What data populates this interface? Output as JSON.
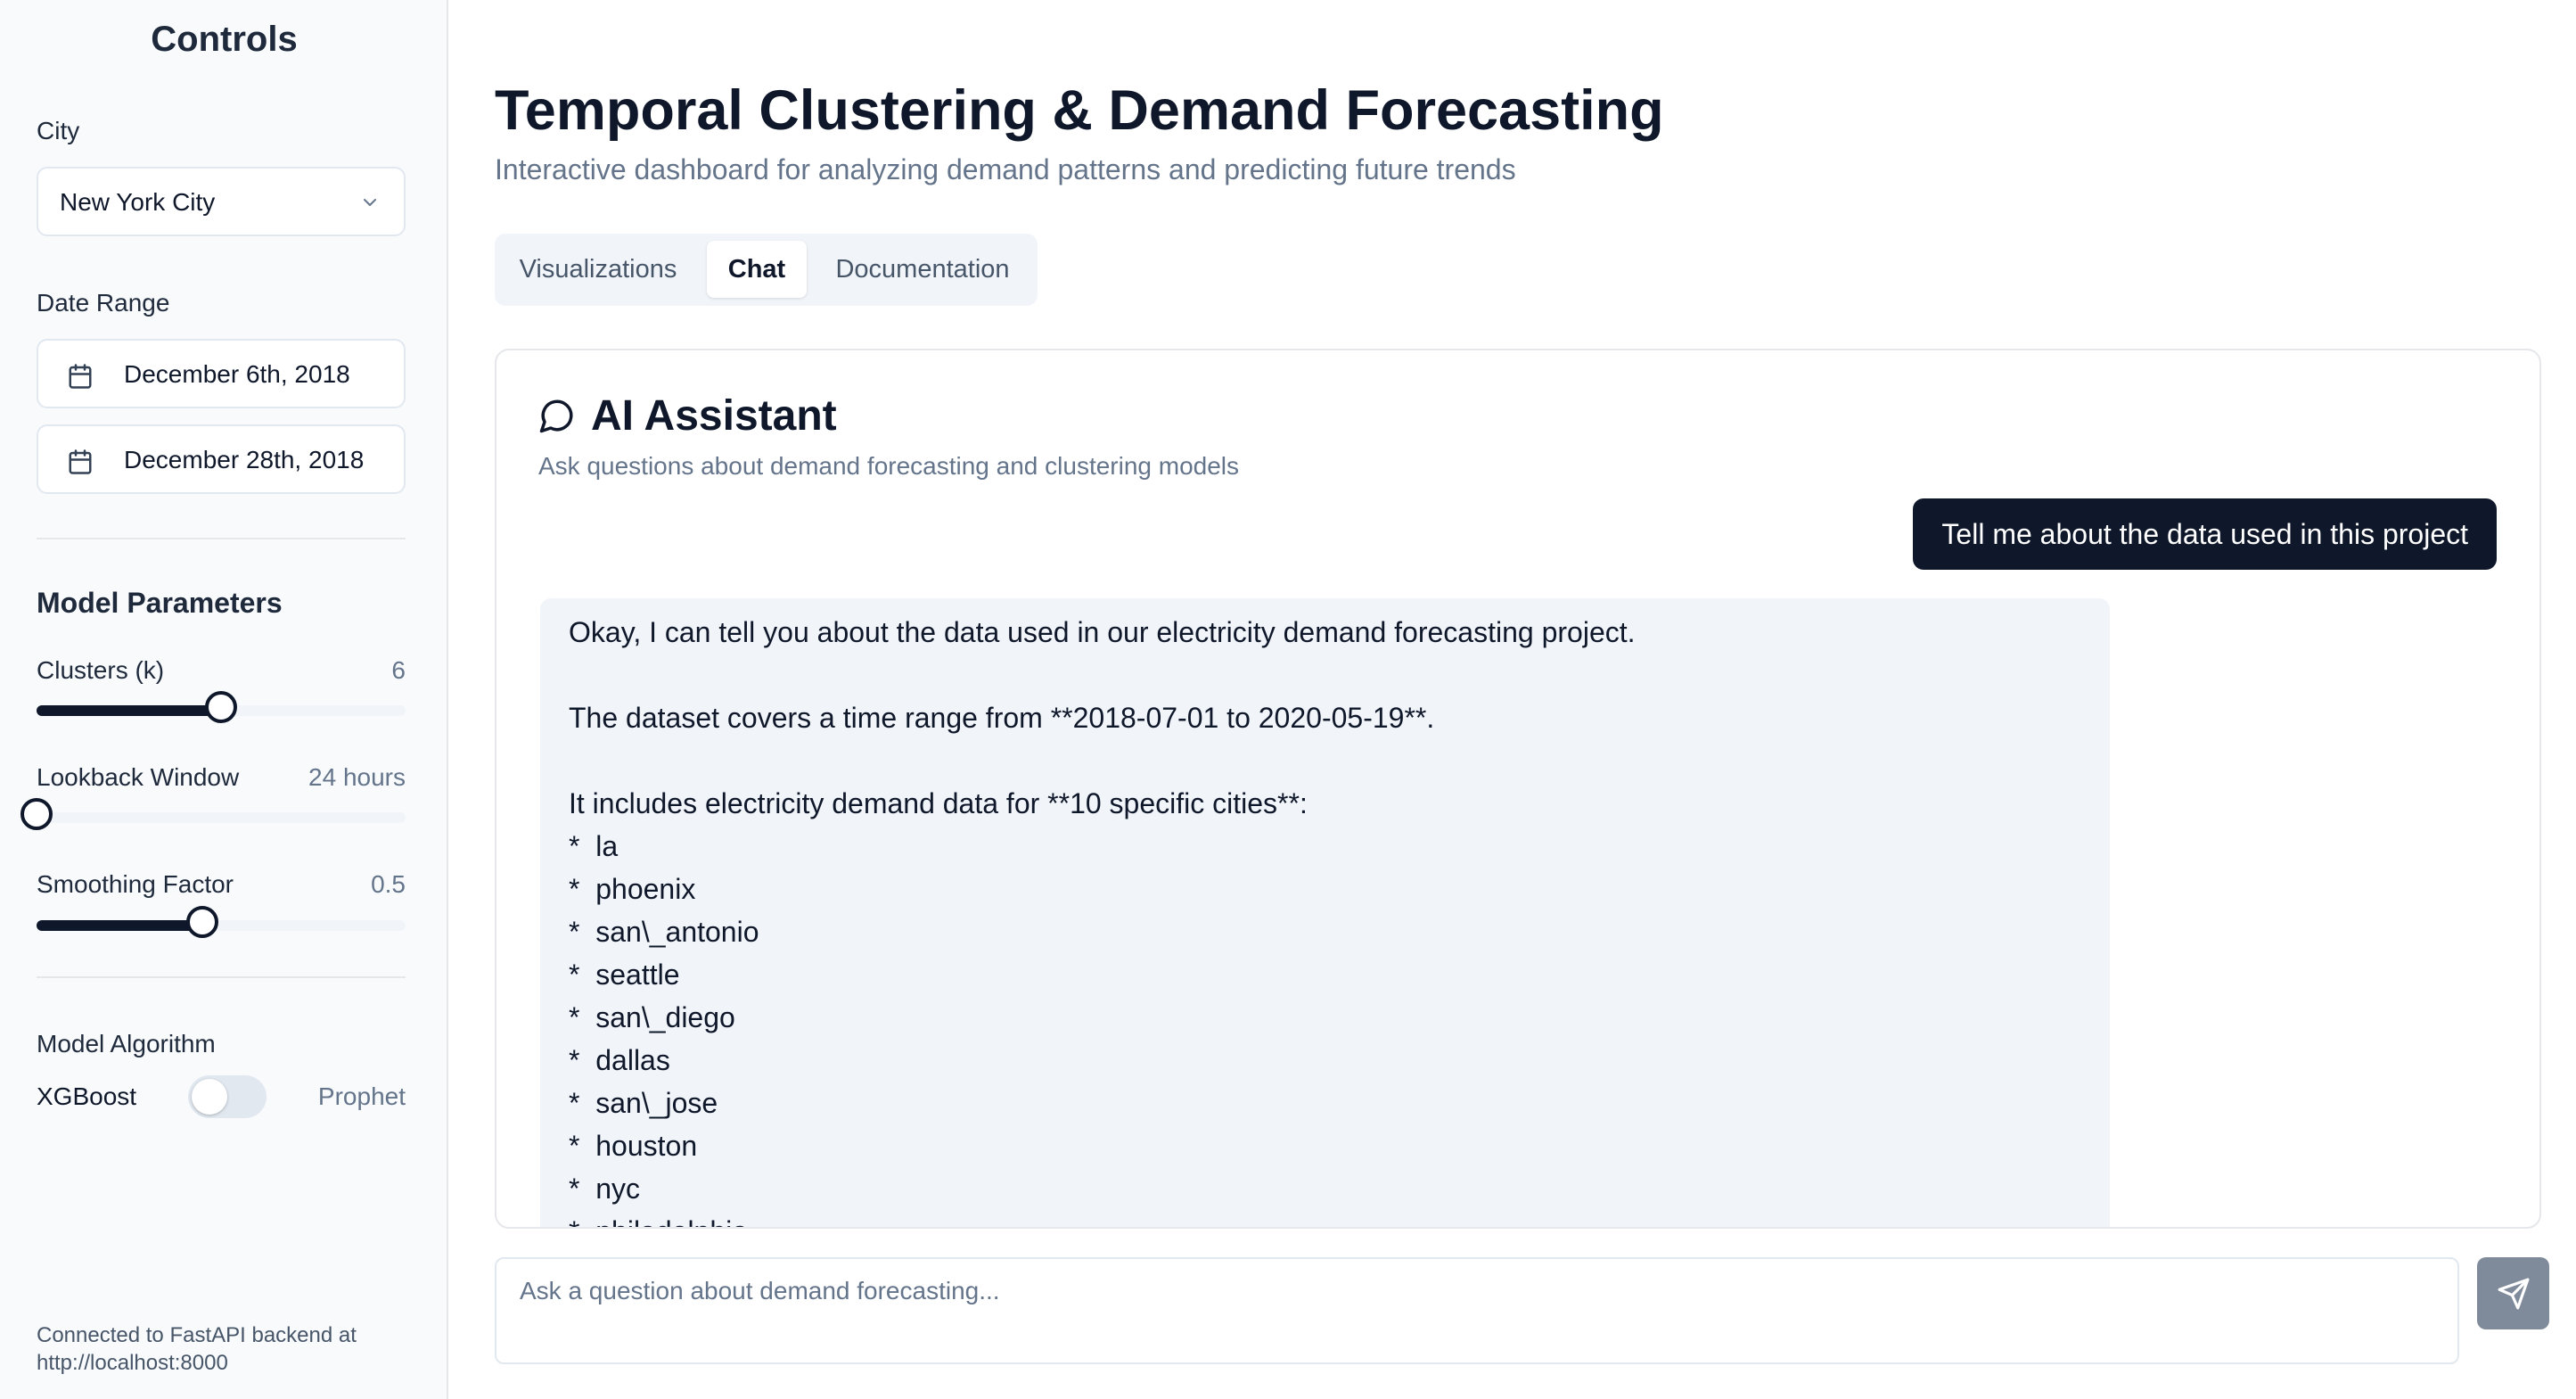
{
  "sidebar": {
    "title": "Controls",
    "city": {
      "label": "City",
      "value": "New York City"
    },
    "date_range": {
      "label": "Date Range",
      "start": "December 6th, 2018",
      "end": "December 28th, 2018"
    },
    "model_params": {
      "title": "Model Parameters",
      "clusters": {
        "label": "Clusters (k)",
        "value": "6",
        "fraction": 0.5
      },
      "lookback": {
        "label": "Lookback Window",
        "value": "24 hours",
        "fraction": 0.0
      },
      "smoothing": {
        "label": "Smoothing Factor",
        "value": "0.5",
        "fraction": 0.45
      }
    },
    "algorithm": {
      "label": "Model Algorithm",
      "left": "XGBoost",
      "right": "Prophet",
      "enabled": false
    },
    "footer": "Connected to FastAPI backend at http://localhost:8000"
  },
  "main": {
    "title": "Temporal Clustering & Demand Forecasting",
    "subtitle": "Interactive dashboard for analyzing demand patterns and predicting future trends",
    "tabs": [
      {
        "label": "Visualizations",
        "active": false
      },
      {
        "label": "Chat",
        "active": true
      },
      {
        "label": "Documentation",
        "active": false
      }
    ]
  },
  "chat": {
    "title": "AI Assistant",
    "subtitle": "Ask questions about demand forecasting and clustering models",
    "user_message": "Tell me about the data used in this project",
    "ai_response": {
      "intro": "Okay, I can tell you about the data used in our electricity demand forecasting project.",
      "range": "The dataset covers a time range from **2018-07-01 to 2020-05-19**.",
      "cities_intro": "It includes electricity demand data for **10 specific cities**:",
      "cities": [
        "la",
        "phoenix",
        "san\\_antonio",
        "seattle",
        "san\\_diego",
        "dallas",
        "san\\_jose",
        "houston",
        "nyc",
        "philadelphia"
      ]
    },
    "input_placeholder": "Ask a question about demand forecasting..."
  },
  "colors": {
    "primary": "#0f172a",
    "muted": "#64748b",
    "sidebar_bg": "#f8fafc",
    "bubble_bg": "#f1f5f9",
    "send_btn": "#7f8a9b"
  }
}
